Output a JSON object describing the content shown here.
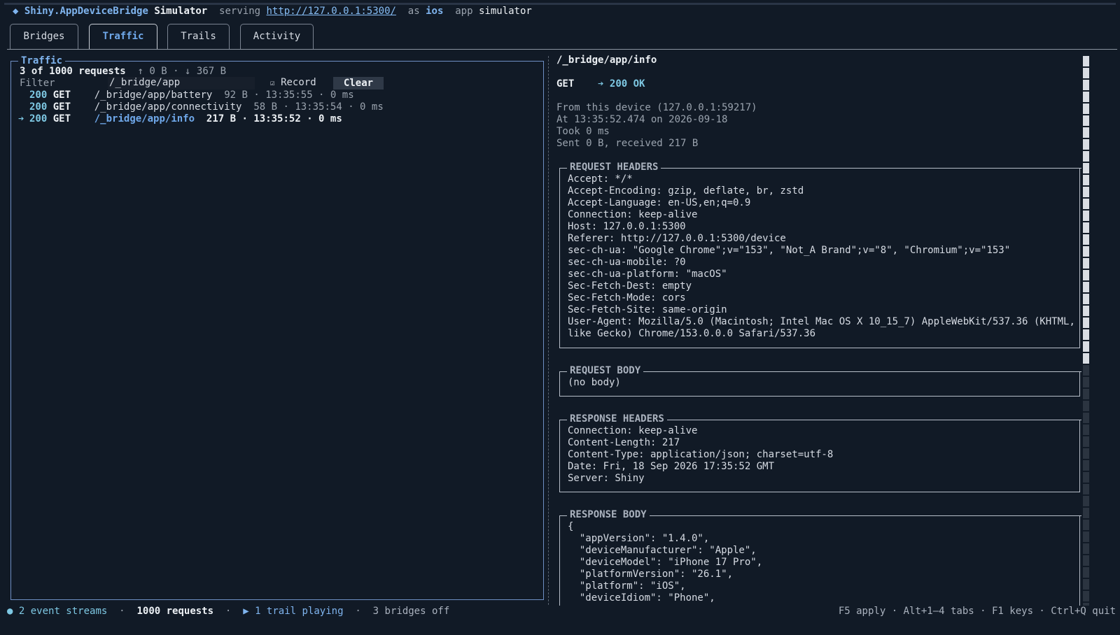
{
  "title": {
    "diamond": "◆",
    "app": "Shiny.AppDeviceBridge",
    "simulator": "Simulator",
    "serving": "serving",
    "url": "http://127.0.0.1:5300/",
    "as": "as",
    "platform": "ios",
    "app_word": "app",
    "mode": "simulator"
  },
  "tabs": [
    "Bridges",
    "Traffic",
    "Trails",
    "Activity"
  ],
  "traffic": {
    "title": "Traffic",
    "summary": "3 of 1000 requests",
    "up": "↑ 0 B",
    "down": "↓ 367 B",
    "filter_label": "Filter",
    "filter_value": "/_bridge/app",
    "record_check": "☑",
    "record_label": "Record",
    "clear_label": "Clear",
    "requests": [
      {
        "marker": "",
        "status": "200",
        "method": "GET",
        "path": "/_bridge/app/battery",
        "meta": "92 B · 13:35:55 · 0 ms"
      },
      {
        "marker": "",
        "status": "200",
        "method": "GET",
        "path": "/_bridge/app/connectivity",
        "meta": "58 B · 13:35:54 · 0 ms"
      },
      {
        "marker": "➔",
        "status": "200",
        "method": "GET",
        "path": "/_bridge/app/info",
        "meta": "217 B · 13:35:52 · 0 ms"
      }
    ]
  },
  "detail": {
    "path": "/_bridge/app/info",
    "method": "GET",
    "arrow": "➔",
    "status": "200 OK",
    "from": "From this device (127.0.0.1:59217)",
    "at": "At 13:35:52.474 on 2026-09-18",
    "took": "Took 0 ms",
    "sent": "Sent 0 B, received 217 B",
    "request_headers_title": "REQUEST HEADERS",
    "request_headers": [
      "Accept: */*",
      "Accept-Encoding: gzip, deflate, br, zstd",
      "Accept-Language: en-US,en;q=0.9",
      "Connection: keep-alive",
      "Host: 127.0.0.1:5300",
      "Referer: http://127.0.0.1:5300/device",
      "sec-ch-ua: \"Google Chrome\";v=\"153\", \"Not_A Brand\";v=\"8\", \"Chromium\";v=\"153\"",
      "sec-ch-ua-mobile: ?0",
      "sec-ch-ua-platform: \"macOS\"",
      "Sec-Fetch-Dest: empty",
      "Sec-Fetch-Mode: cors",
      "Sec-Fetch-Site: same-origin",
      "User-Agent: Mozilla/5.0 (Macintosh; Intel Mac OS X 10_15_7) AppleWebKit/537.36 (KHTML,",
      "like Gecko) Chrome/153.0.0.0 Safari/537.36"
    ],
    "request_body_title": "REQUEST BODY",
    "request_body": "(no body)",
    "response_headers_title": "RESPONSE HEADERS",
    "response_headers": [
      "Connection: keep-alive",
      "Content-Length: 217",
      "Content-Type: application/json; charset=utf-8",
      "Date: Fri, 18 Sep 2026 17:35:52 GMT",
      "Server: Shiny"
    ],
    "response_body_title": "RESPONSE BODY",
    "response_body": [
      "{",
      "  \"appVersion\": \"1.4.0\",",
      "  \"deviceManufacturer\": \"Apple\",",
      "  \"deviceModel\": \"iPhone 17 Pro\",",
      "  \"platformVersion\": \"26.1\",",
      "  \"platform\": \"iOS\",",
      "  \"deviceIdiom\": \"Phone\","
    ]
  },
  "status": {
    "dot": "●",
    "streams": "2 event streams",
    "sep": "·",
    "requests": "1000 requests",
    "play": "▶",
    "trail": "1 trail playing",
    "bridges": "3 bridges off",
    "keys": "F5 apply · Alt+1–4 tabs · F1 keys · Ctrl+Q quit"
  },
  "colors": {
    "background": "#111a26",
    "accent": "#6fa8ea",
    "status_ok": "#7ec8e3",
    "panel_border": "#6e8fc4"
  }
}
